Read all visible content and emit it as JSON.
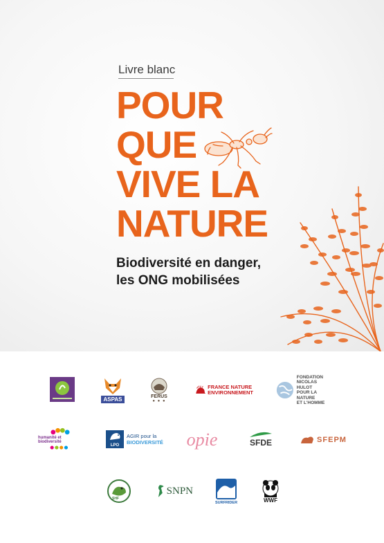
{
  "cover": {
    "kicker": "Livre blanc",
    "title_lines": [
      "POUR",
      "QUE",
      "VIVE LA",
      "NATURE"
    ],
    "subtitle_lines": [
      "Biodiversité en danger,",
      "les ONG mobilisées"
    ]
  },
  "logos": {
    "aspas": "ASPAS",
    "ferus": "FERUS",
    "fne_line1": "FRANCE NATURE",
    "fne_line2": "ENVIRONNEMENT",
    "fnh_line1": "FONDATION",
    "fnh_line2": "NICOLAS HULOT",
    "fnh_line3": "POUR LA NATURE",
    "fnh_line4": "ET L'HOMME",
    "humanite": "humanité et biodiversité",
    "lpo_line1": "AGIR pour la",
    "lpo_line2": "BIODIVERSITÉ",
    "lpo_badge": "LPO",
    "opie": "opie",
    "sfde": "SFDE",
    "sfepm": "SFEPM",
    "snpn": "SNPN",
    "surfrider": "SURFRIDER",
    "wwf": "WWF",
    "shf": "SHF"
  },
  "colors": {
    "accent": "#e8641c",
    "text": "#1a1a1a"
  }
}
